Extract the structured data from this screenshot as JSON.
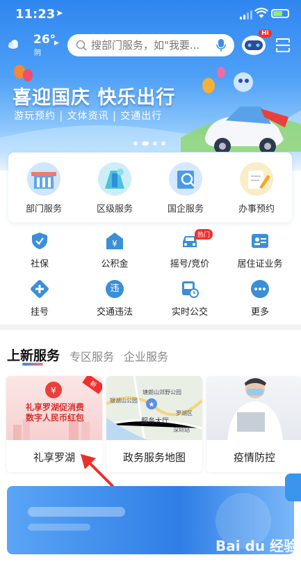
{
  "status_bar": {
    "time": "11:23",
    "location_icon": "location-arrow-icon"
  },
  "weather": {
    "temp": "26°",
    "condition": "阴"
  },
  "search": {
    "placeholder": "搜部门服务，如\"我要..."
  },
  "assistant": {
    "badge": "Hi"
  },
  "banner": {
    "title": "喜迎国庆  快乐出行",
    "subtitle": "游玩预约 | 文体资讯 | 交通出行",
    "page_count": 4,
    "active_page": 2
  },
  "main_services": [
    {
      "label": "部门服务",
      "icon": "building-icon"
    },
    {
      "label": "区级服务",
      "icon": "district-icon"
    },
    {
      "label": "国企服务",
      "icon": "enterprise-icon"
    },
    {
      "label": "办事预约",
      "icon": "appointment-icon"
    }
  ],
  "quick_services": [
    {
      "label": "社保",
      "icon": "shield-check-icon"
    },
    {
      "label": "公积金",
      "icon": "house-yen-icon"
    },
    {
      "label": "摇号/竞价",
      "icon": "car-icon",
      "badge": "热门"
    },
    {
      "label": "居住证业务",
      "icon": "id-card-icon"
    },
    {
      "label": "挂号",
      "icon": "medical-plus-icon"
    },
    {
      "label": "交通违法",
      "icon": "violation-icon",
      "icon_text": "违"
    },
    {
      "label": "实时公交",
      "icon": "bus-clock-icon"
    },
    {
      "label": "更多",
      "icon": "more-icon"
    }
  ],
  "tabs": [
    "上新服务",
    "专区服务",
    "企业服务"
  ],
  "active_tab": 0,
  "service_cards": [
    {
      "label": "礼享罗湖",
      "image_text": "礼享罗湖促消费\n数字人民币红包",
      "tag": "新"
    },
    {
      "label": "政务服务地图",
      "map_labels": [
        "塘朗山郊野公园",
        "银湖山公园",
        "罗湖区",
        "服务大厅",
        "深圳站"
      ]
    },
    {
      "label": "疫情防控"
    }
  ],
  "watermark": "Bai du 经验",
  "colors": {
    "primary": "#2f86f0",
    "accent_red": "#f0302d",
    "icon_blue": "#3a8fd8"
  }
}
